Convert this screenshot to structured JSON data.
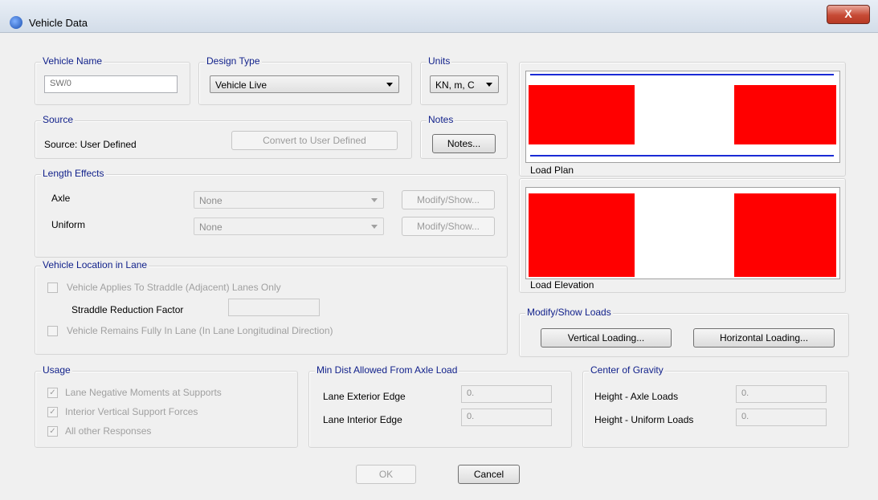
{
  "window": {
    "title": "Vehicle Data",
    "close_glyph": "X"
  },
  "vehicle_name": {
    "label": "Vehicle Name",
    "value": "SW/0"
  },
  "design_type": {
    "label": "Design Type",
    "value": "Vehicle Live"
  },
  "units": {
    "label": "Units",
    "value": "KN, m, C"
  },
  "source": {
    "label": "Source",
    "text": "Source: User Defined",
    "convert_button": "Convert to User Defined"
  },
  "notes": {
    "label": "Notes",
    "button": "Notes..."
  },
  "length_effects": {
    "label": "Length Effects",
    "axle_label": "Axle",
    "axle_value": "None",
    "uniform_label": "Uniform",
    "uniform_value": "None",
    "modify_button": "Modify/Show..."
  },
  "location": {
    "label": "Vehicle Location in Lane",
    "straddle_check": "Vehicle Applies To Straddle (Adjacent) Lanes Only",
    "reduction_label": "Straddle Reduction Factor",
    "reduction_value": "",
    "fully_check": "Vehicle Remains Fully In Lane (In Lane Longitudinal Direction)"
  },
  "load_plan_label": "Load Plan",
  "load_elevation_label": "Load Elevation",
  "modify_loads": {
    "label": "Modify/Show Loads",
    "vertical": "Vertical Loading...",
    "horizontal": "Horizontal Loading..."
  },
  "usage": {
    "label": "Usage",
    "items": [
      "Lane Negative Moments at Supports",
      "Interior Vertical Support Forces",
      "All other Responses"
    ],
    "checked": [
      true,
      true,
      true
    ]
  },
  "min_dist": {
    "label": "Min Dist Allowed From Axle Load",
    "exterior_label": "Lane Exterior Edge",
    "exterior_value": "0.",
    "interior_label": "Lane Interior Edge",
    "interior_value": "0."
  },
  "cog": {
    "label": "Center of Gravity",
    "axle_label": "Height - Axle Loads",
    "axle_value": "0.",
    "uniform_label": "Height - Uniform Loads",
    "uniform_value": "0."
  },
  "footer": {
    "ok": "OK",
    "cancel": "Cancel"
  },
  "colors": {
    "group_title": "#0f1f8a",
    "load_fill": "#ff0000",
    "lane_line": "#1a2bd6"
  }
}
